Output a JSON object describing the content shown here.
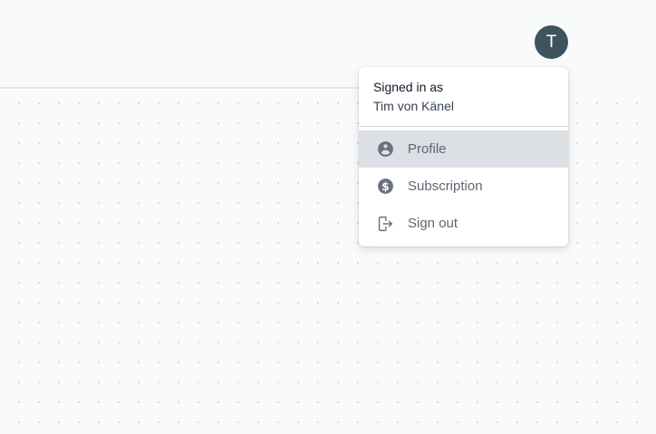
{
  "header": {
    "avatar_initial": "T"
  },
  "user_menu": {
    "signed_in_label": "Signed in as",
    "user_name": "Tim von Känel",
    "items": [
      {
        "label": "Profile",
        "icon": "user-circle-icon",
        "highlighted": true
      },
      {
        "label": "Subscription",
        "icon": "dollar-circle-icon",
        "highlighted": false
      },
      {
        "label": "Sign out",
        "icon": "logout-icon",
        "highlighted": false
      }
    ]
  },
  "colors": {
    "avatar_bg": "#3f535f",
    "highlight_bg": "#dcdfe4",
    "menu_text": "#5f6673",
    "canvas_bg": "#f9fafa"
  }
}
